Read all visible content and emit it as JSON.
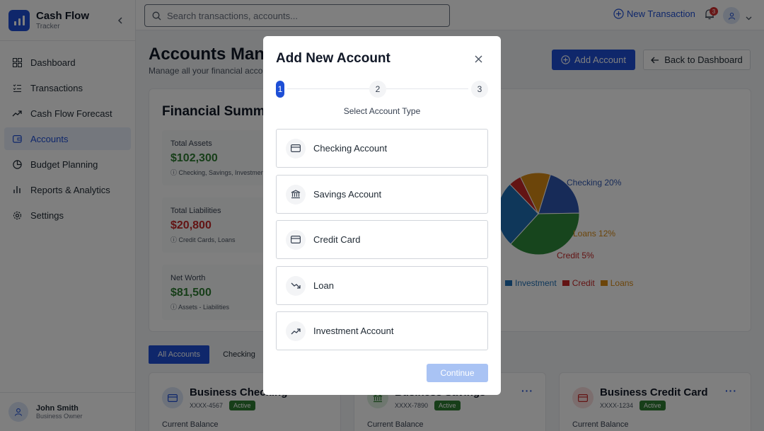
{
  "brand": {
    "title": "Cash Flow",
    "subtitle": "Tracker"
  },
  "sidebar": {
    "items": [
      {
        "label": "Dashboard",
        "icon": "dashboard-icon"
      },
      {
        "label": "Transactions",
        "icon": "list-icon"
      },
      {
        "label": "Cash Flow Forecast",
        "icon": "trending-up-icon"
      },
      {
        "label": "Accounts",
        "icon": "wallet-icon",
        "active": true
      },
      {
        "label": "Budget Planning",
        "icon": "pie-icon"
      },
      {
        "label": "Reports & Analytics",
        "icon": "bar-chart-icon"
      },
      {
        "label": "Settings",
        "icon": "gear-icon"
      }
    ],
    "user": {
      "name": "John Smith",
      "role": "Business Owner"
    }
  },
  "topbar": {
    "search_placeholder": "Search transactions, accounts...",
    "new_transaction": "New Transaction",
    "notification_count": "3"
  },
  "page": {
    "title": "Accounts Management",
    "subtitle": "Manage all your financial accounts",
    "add_account": "Add Account",
    "back_to_dashboard": "Back to Dashboard"
  },
  "summary": {
    "title": "Financial Summary",
    "stats": [
      {
        "label": "Total Assets",
        "value": "$102,300",
        "note": "Checking, Savings, Investments"
      },
      {
        "label": "Total Liabilities",
        "value": "$20,800",
        "note": "Credit Cards, Loans"
      },
      {
        "label": "Net Worth",
        "value": "$81,500",
        "note": "Assets - Liabilities"
      }
    ]
  },
  "chart_data": {
    "type": "pie",
    "series": [
      {
        "name": "Checking",
        "value": 20
      },
      {
        "name": "Savings",
        "value": 37
      },
      {
        "name": "Investment",
        "value": 26
      },
      {
        "name": "Credit",
        "value": 5
      },
      {
        "name": "Loans",
        "value": 12
      }
    ],
    "slice_labels": [
      "Checking 20%",
      "Loans 12%",
      "Credit 5%"
    ],
    "legend": [
      "Investment",
      "Credit",
      "Loans"
    ],
    "colors": {
      "Checking": "#2f56b0",
      "Savings": "#2e8b3a",
      "Investment": "#1e6fb5",
      "Credit": "#c62828",
      "Loans": "#d88a14"
    }
  },
  "tabs": [
    "All Accounts",
    "Checking"
  ],
  "accounts": [
    {
      "name": "Business Checking",
      "number": "XXXX-4567",
      "status": "Active",
      "balance_label": "Current Balance",
      "icon": "card-icon",
      "tint": "#dbe4f7",
      "color": "#1e4fd6"
    },
    {
      "name": "Business Savings",
      "number": "XXXX-7890",
      "status": "Active",
      "balance_label": "Current Balance",
      "icon": "bank-icon",
      "tint": "#dcefdf",
      "color": "#2e7d32"
    },
    {
      "name": "Business Credit Card",
      "number": "XXXX-1234",
      "status": "Active",
      "balance_label": "Current Balance",
      "icon": "card-icon",
      "tint": "#f8dcdc",
      "color": "#c62828"
    }
  ],
  "modal": {
    "title": "Add New Account",
    "steps": [
      "1",
      "2",
      "3"
    ],
    "step_caption": "Select Account Type",
    "options": [
      {
        "label": "Checking Account",
        "icon": "card-icon"
      },
      {
        "label": "Savings Account",
        "icon": "bank-icon"
      },
      {
        "label": "Credit Card",
        "icon": "card-icon"
      },
      {
        "label": "Loan",
        "icon": "trending-down-icon"
      },
      {
        "label": "Investment Account",
        "icon": "trending-up-icon"
      }
    ],
    "continue": "Continue"
  }
}
